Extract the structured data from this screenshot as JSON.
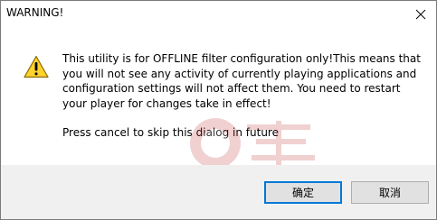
{
  "window": {
    "title": "WARNING!"
  },
  "message": {
    "lines": [
      "This utility is for OFFLINE filter configuration only!This means that",
      "you will not see any activity of currently playing applications and",
      "configuration settings will not affect them. You need to restart",
      "your player for changes take in effect!"
    ],
    "hint": "Press cancel to skip this dialog in future"
  },
  "buttons": {
    "ok_label": "确定",
    "cancel_label": "取消"
  },
  "icons": {
    "warning": "warning-icon",
    "close": "close-icon"
  },
  "colors": {
    "warning_fill": "#ffd22e",
    "warning_border": "#8a6a00",
    "default_button_border": "#0078d7",
    "footer_background": "#f0f0f0"
  }
}
